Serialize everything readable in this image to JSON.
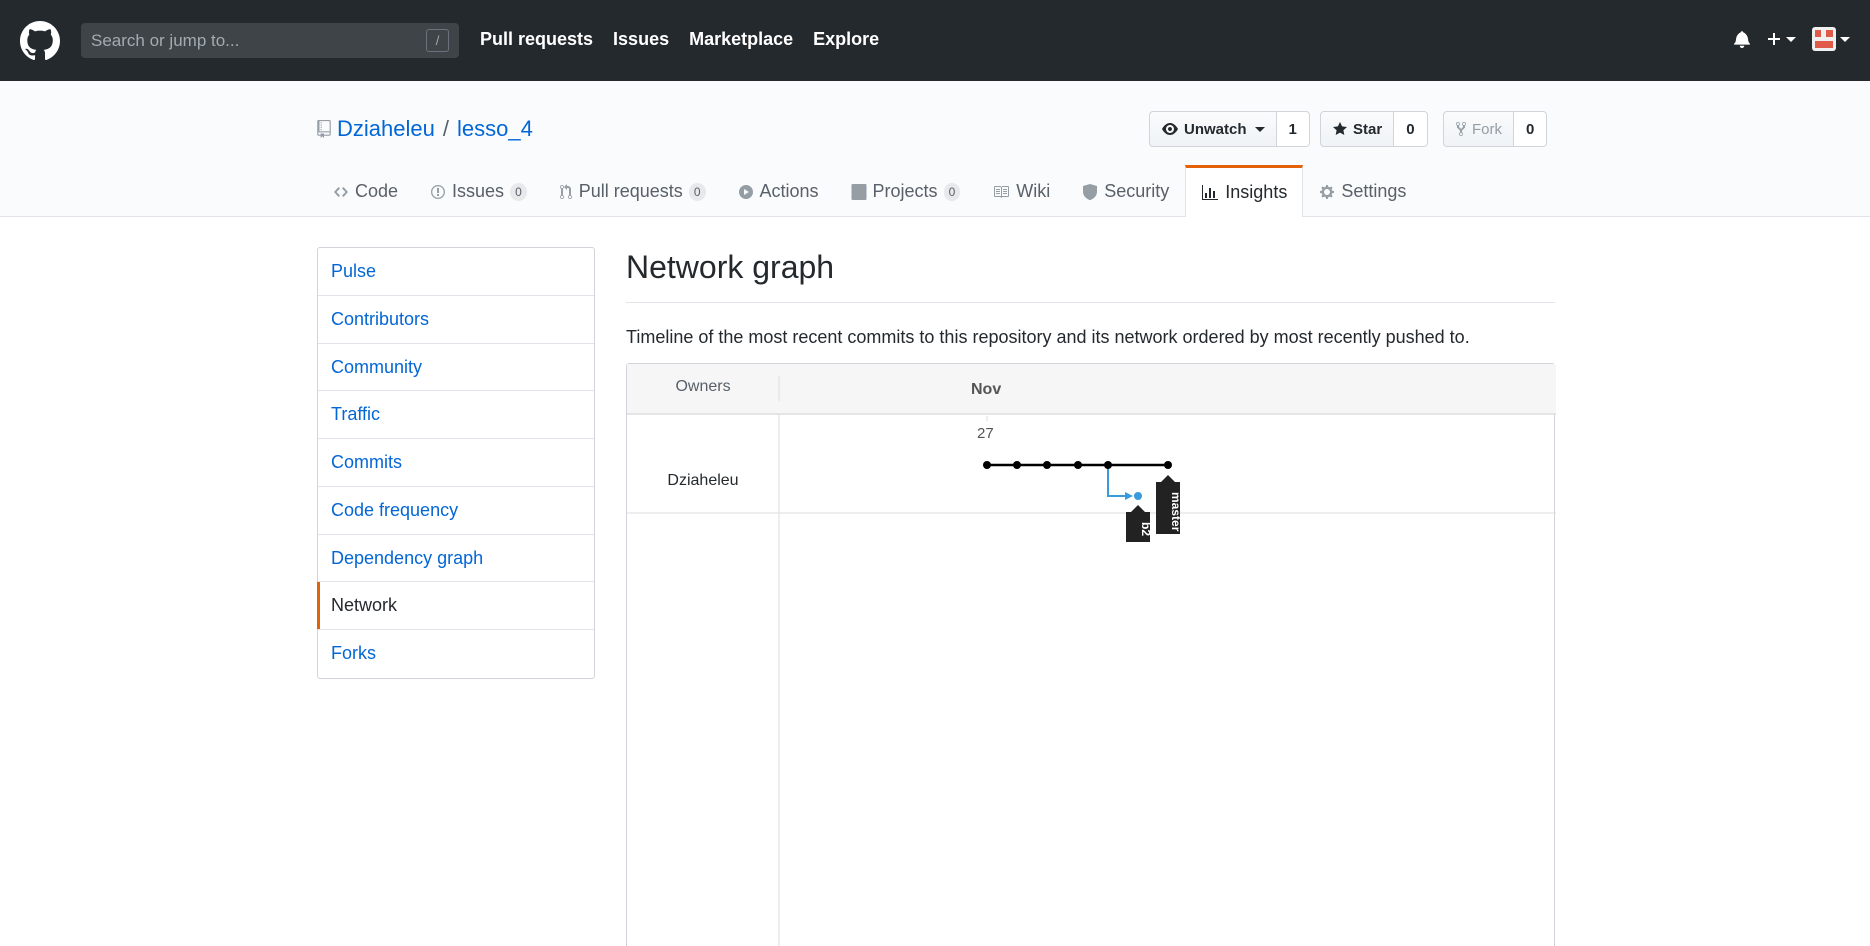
{
  "header": {
    "search_placeholder": "Search or jump to...",
    "search_shortcut": "/",
    "nav": [
      "Pull requests",
      "Issues",
      "Marketplace",
      "Explore"
    ],
    "icons": [
      "github-logo-icon",
      "bell-icon",
      "plus-icon",
      "avatar"
    ]
  },
  "repo": {
    "owner": "Dziaheleu",
    "separator": "/",
    "name": "lesso_4",
    "watch_label": "Unwatch",
    "watch_count": "1",
    "star_label": "Star",
    "star_count": "0",
    "fork_label": "Fork",
    "fork_count": "0"
  },
  "tabs": [
    {
      "label": "Code",
      "icon": "code-icon"
    },
    {
      "label": "Issues",
      "counter": "0",
      "icon": "issue-icon"
    },
    {
      "label": "Pull requests",
      "counter": "0",
      "icon": "git-pull-request-icon"
    },
    {
      "label": "Actions",
      "icon": "play-icon"
    },
    {
      "label": "Projects",
      "counter": "0",
      "icon": "project-icon"
    },
    {
      "label": "Wiki",
      "icon": "book-icon"
    },
    {
      "label": "Security",
      "icon": "shield-icon"
    },
    {
      "label": "Insights",
      "icon": "graph-icon",
      "selected": true
    },
    {
      "label": "Settings",
      "icon": "gear-icon"
    }
  ],
  "sidebar": {
    "items": [
      "Pulse",
      "Contributors",
      "Community",
      "Traffic",
      "Commits",
      "Code frequency",
      "Dependency graph",
      "Network",
      "Forks"
    ],
    "selected": "Network"
  },
  "main": {
    "title": "Network graph",
    "description": "Timeline of the most recent commits to this repository and its network ordered by most recently pushed to."
  },
  "network": {
    "owners_header": "Owners",
    "month": "Nov",
    "day": "27",
    "owner": "Dziaheleu",
    "branches": [
      "master",
      "b2"
    ],
    "colors": {
      "master": "#000000",
      "b2": "#3a9bdc"
    }
  }
}
